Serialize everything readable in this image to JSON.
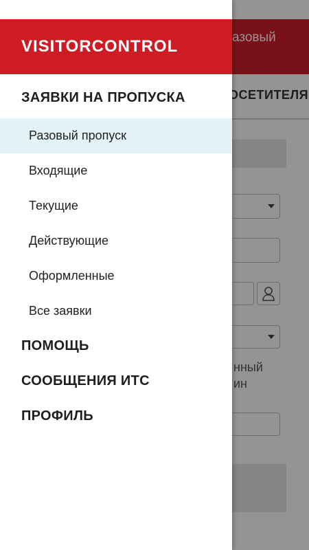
{
  "background": {
    "header_title_fragment": "азовый",
    "tab_label_fragment": "ОСЕТИТЕЛЯ",
    "text_fragment_1": "нный",
    "text_fragment_2": "ин"
  },
  "drawer": {
    "app_title": "VISITORCONTROL",
    "sections": {
      "passes": {
        "title": "ЗАЯВКИ НА ПРОПУСКА",
        "items": [
          {
            "label": "Разовый пропуск",
            "active": true
          },
          {
            "label": "Входящие"
          },
          {
            "label": "Текущие"
          },
          {
            "label": "Действующие"
          },
          {
            "label": "Оформленные"
          },
          {
            "label": "Все заявки"
          }
        ]
      },
      "help": {
        "title": "ПОМОЩЬ"
      },
      "messages": {
        "title": "СООБЩЕНИЯ ИТС"
      },
      "profile": {
        "title": "ПРОФИЛЬ"
      }
    }
  },
  "colors": {
    "brand_red": "#cd1c24",
    "active_item_bg": "#e3f3f7",
    "scrim": "rgba(0,0,0,0.42)"
  }
}
